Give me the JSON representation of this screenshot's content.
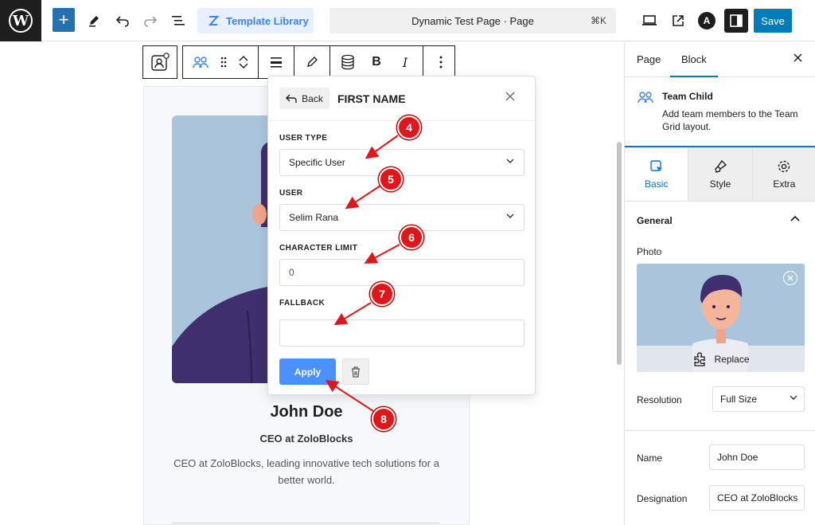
{
  "topbar": {
    "template_library_label": "Template Library",
    "document_title": "Dynamic Test Page · Page",
    "shortcut": "⌘K",
    "save_label": "Save"
  },
  "card": {
    "name": "John Doe",
    "role": "CEO at ZoloBlocks",
    "description": "CEO at ZoloBlocks, leading innovative tech solutions for a better world."
  },
  "dynamic_popover": {
    "back_label": "Back",
    "title": "FIRST NAME",
    "user_type_label": "USER TYPE",
    "user_type_value": "Specific User",
    "user_label": "USER",
    "user_value": "Selim Rana",
    "character_limit_label": "CHARACTER LIMIT",
    "character_limit_value": "0",
    "fallback_label": "FALLBACK",
    "fallback_value": "",
    "apply_label": "Apply"
  },
  "annotations": [
    "4",
    "5",
    "6",
    "7",
    "8"
  ],
  "sidebar": {
    "tabs": [
      "Page",
      "Block"
    ],
    "active_tab": "Block",
    "block_title": "Team Child",
    "block_description": "Add team members to the Team Grid layout.",
    "panel_tabs": [
      "Basic",
      "Style",
      "Extra"
    ],
    "active_panel_tab": "Basic",
    "section_title": "General",
    "photo_label": "Photo",
    "replace_label": "Replace",
    "resolution_label": "Resolution",
    "resolution_value": "Full Size",
    "name_label": "Name",
    "name_value": "John Doe",
    "designation_label": "Designation",
    "designation_value": "CEO at ZoloBlocks"
  },
  "colors": {
    "accent_blue": "#007cba",
    "apply_blue": "#4a90ff",
    "marker_red": "#e0161b",
    "photo_bg": "#a9c4db",
    "suit_purple": "#3f2f6e"
  }
}
